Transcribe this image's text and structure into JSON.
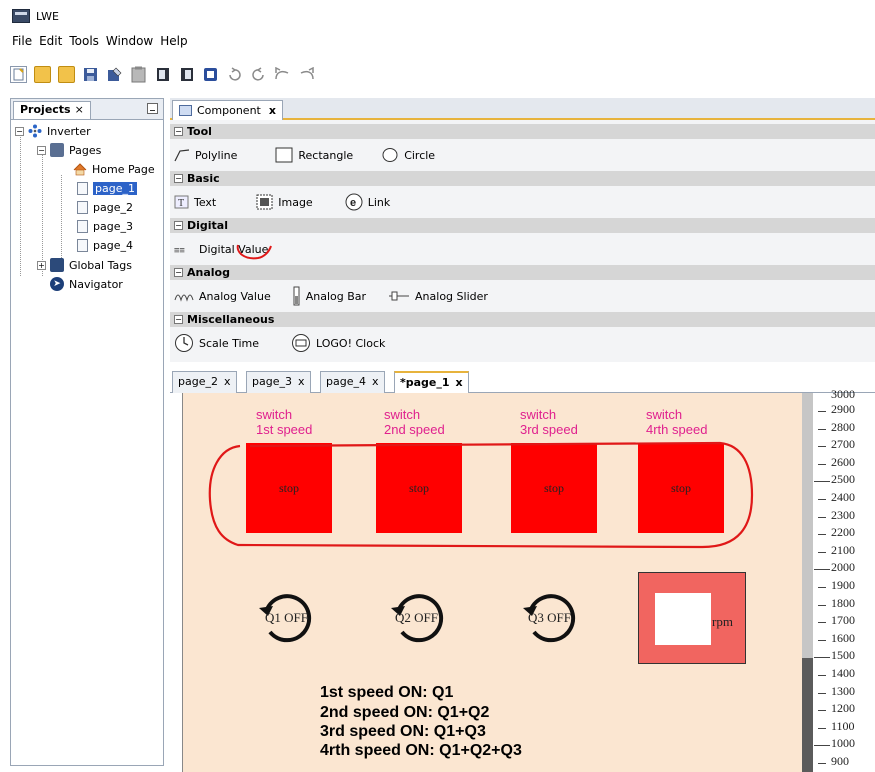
{
  "app": {
    "title": "LWE"
  },
  "menu": [
    "File",
    "Edit",
    "Tools",
    "Window",
    "Help"
  ],
  "toolbar_icons": [
    "new-icon",
    "open-icon",
    "open-folder-icon",
    "save-icon",
    "save-as-icon",
    "clipboard-icon",
    "doc-icon",
    "doc2-icon",
    "transfer-icon",
    "undo-icon",
    "redo-icon",
    "undo-all-icon",
    "redo-all-icon"
  ],
  "projects": {
    "tab_label": "Projects",
    "close": "×",
    "tree": {
      "root": "Inverter",
      "pages_folder": "Pages",
      "home": "Home Page",
      "pages": [
        "page_1",
        "page_2",
        "page_3",
        "page_4"
      ],
      "selected": "page_1",
      "global_tags": "Global Tags",
      "navigator": "Navigator"
    }
  },
  "component": {
    "tab_label": "Component",
    "close": "x",
    "categories": {
      "tool": {
        "label": "Tool",
        "items": [
          "Polyline",
          "Rectangle",
          "Circle"
        ]
      },
      "basic": {
        "label": "Basic",
        "items": [
          "Text",
          "Image",
          "Link"
        ]
      },
      "digital": {
        "label": "Digital",
        "items": [
          "Digital Value"
        ]
      },
      "analog": {
        "label": "Analog",
        "items": [
          "Analog Value",
          "Analog Bar",
          "Analog Slider"
        ]
      },
      "misc": {
        "label": "Miscellaneous",
        "items": [
          "Scale Time",
          "LOGO! Clock"
        ]
      }
    },
    "collapse_glyph": "−"
  },
  "editor": {
    "tabs": [
      {
        "label": "page_2",
        "close": "x"
      },
      {
        "label": "page_3",
        "close": "x"
      },
      {
        "label": "page_4",
        "close": "x"
      },
      {
        "label": "*page_1",
        "close": "x",
        "active": true
      }
    ],
    "switches": [
      {
        "line1": "switch",
        "line2": "1st speed",
        "button": "stop"
      },
      {
        "line1": "switch",
        "line2": "2nd speed",
        "button": "stop"
      },
      {
        "line1": "switch",
        "line2": "3rd speed",
        "button": "stop"
      },
      {
        "line1": "switch",
        "line2": "4rth speed",
        "button": "stop"
      }
    ],
    "outputs": [
      "Q1 OFF",
      "Q2 OFF",
      "Q3 OFF"
    ],
    "rpm_label": "rpm",
    "speed_notes": [
      "1st speed ON: Q1",
      "2nd speed ON: Q1+Q2",
      "3rd speed ON: Q1+Q3",
      "4rth speed ON: Q1+Q2+Q3"
    ],
    "ruler": {
      "top_partial": "3000",
      "labels": [
        "2900",
        "2800",
        "2700",
        "2600",
        "2500",
        "2400",
        "2300",
        "2200",
        "2100",
        "2000",
        "1900",
        "1800",
        "1700",
        "1600",
        "1500",
        "1400",
        "1300",
        "1200",
        "1100",
        "1000",
        "900"
      ]
    }
  },
  "colors": {
    "switch_label": "#e0208e",
    "stop_button": "#ff0000",
    "canvas_bg": "#fbe6d1",
    "annotation": "#e01818",
    "rpm_box": "#f16560"
  }
}
